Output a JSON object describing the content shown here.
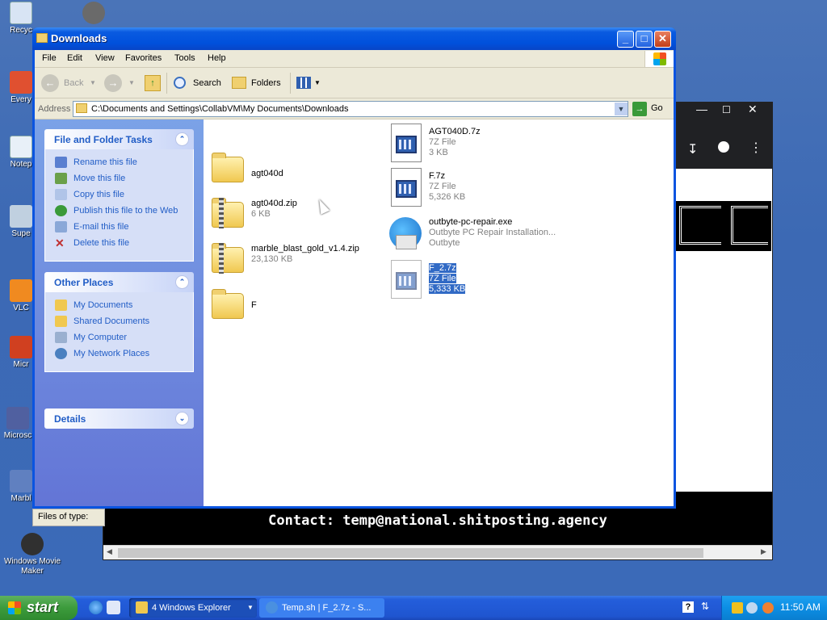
{
  "desktop": {
    "icons": [
      {
        "label": "Recyc",
        "icon": "recycle-bin-icon"
      },
      {
        "label": "Every",
        "icon": "everything-icon"
      },
      {
        "label": "Notep",
        "icon": "notepad-icon"
      },
      {
        "label": "Supe",
        "icon": "app-icon"
      },
      {
        "label": "VLC",
        "icon": "vlc-icon"
      },
      {
        "label": "Micr",
        "icon": "office-icon"
      },
      {
        "label": "Microsc",
        "icon": "studio-icon"
      },
      {
        "label": "Marbl",
        "icon": "marble-icon"
      },
      {
        "label": "Windows Movie Maker",
        "icon": "movie-maker-icon"
      }
    ]
  },
  "terminal": {
    "contact": "Contact: temp@national.shitposting.agency"
  },
  "explorer": {
    "title": "Downloads",
    "menu": [
      "File",
      "Edit",
      "View",
      "Favorites",
      "Tools",
      "Help"
    ],
    "toolbar": {
      "back": "Back",
      "search": "Search",
      "folders": "Folders"
    },
    "address": {
      "label": "Address",
      "path": "C:\\Documents and Settings\\CollabVM\\My Documents\\Downloads",
      "go": "Go"
    },
    "tasks": {
      "file_folder": {
        "title": "File and Folder Tasks",
        "items": [
          {
            "label": "Rename this file",
            "color": "#5a7fd0"
          },
          {
            "label": "Move this file",
            "color": "#6aa04a"
          },
          {
            "label": "Copy this file",
            "color": "#b0c4e8"
          },
          {
            "label": "Publish this file to the Web",
            "color": "#3a9a3a"
          },
          {
            "label": "E-mail this file",
            "color": "#8aa8d8"
          },
          {
            "label": "Delete this file",
            "color": "#c03030"
          }
        ]
      },
      "other_places": {
        "title": "Other Places",
        "items": [
          {
            "label": "My Documents",
            "color": "#f0c850"
          },
          {
            "label": "Shared Documents",
            "color": "#f0c850"
          },
          {
            "label": "My Computer",
            "color": "#9ab0d0"
          },
          {
            "label": "My Network Places",
            "color": "#4a80c0"
          }
        ]
      },
      "details": {
        "title": "Details"
      }
    },
    "files": [
      {
        "name": "agt040d",
        "type": "",
        "size": "",
        "kind": "folder"
      },
      {
        "name": "AGT040D.7z",
        "type": "7Z File",
        "size": "3 KB",
        "kind": "7z"
      },
      {
        "name": "agt040d.zip",
        "type": "",
        "size": "6 KB",
        "kind": "zip"
      },
      {
        "name": "F.7z",
        "type": "7Z File",
        "size": "5,326 KB",
        "kind": "7z"
      },
      {
        "name": "marble_blast_gold_v1.4.zip",
        "type": "",
        "size": "23,130 KB",
        "kind": "zip"
      },
      {
        "name": "outbyte-pc-repair.exe",
        "type": "Outbyte PC Repair Installation...",
        "size": "Outbyte",
        "kind": "exe"
      },
      {
        "name": "F",
        "type": "",
        "size": "",
        "kind": "folder"
      },
      {
        "name": "F_2.7z",
        "type": "7Z File",
        "size": "5,333 KB",
        "kind": "7z",
        "selected": true
      }
    ],
    "status": "Files of type:"
  },
  "taskbar": {
    "start": "start",
    "tasks": [
      {
        "label": "4 Windows Explorer",
        "color": "#f0c850"
      },
      {
        "label": "Temp.sh | F_2.7z - S...",
        "color": "#4a90e0"
      }
    ],
    "clock": "11:50 AM"
  }
}
